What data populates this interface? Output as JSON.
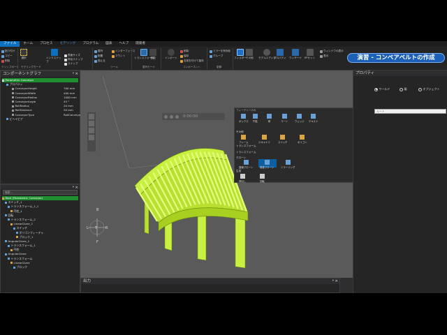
{
  "menu": [
    "ファイル",
    "ホーム",
    "プロセス",
    "モデリング",
    "プログラム",
    "図表",
    "ヘルプ",
    "開発者"
  ],
  "ribbon": {
    "clipboard_group": "クリップボード",
    "clipboard_items": [
      "貼り付け",
      "コピー",
      "削除"
    ],
    "select_label": "選択",
    "snap_label": "インクスナップ",
    "checks": [
      "表面サイズ",
      "押出スナップ",
      "スナップ"
    ],
    "modeling_group": "モデリングモード",
    "items2": [
      "整列",
      "配置",
      "揃える",
      "表示"
    ],
    "interface_items": [
      "インターフェース",
      "マウント"
    ],
    "tool_group": "ツール",
    "transform_label": "トランスフォーム",
    "move_label": "移動",
    "align_mode_label": "整列モード",
    "align_mode_group": "整列モード",
    "import_group": "インポート",
    "component_group": "コンポーネント",
    "component_items": [
      "削除",
      "保存",
      "名前を付けて保存"
    ],
    "filter_label": "フィルター",
    "filter_items": [
      "ミラー",
      "その他"
    ],
    "mirror_items": [
      "ミラーを有効化",
      "グループ"
    ],
    "model_group": "制御",
    "model_editor": "モデルエディタ",
    "property_label": "プロパティ",
    "wizard_label": "ウィザード",
    "window_items": [
      "ウィンドウの表示",
      "表示"
    ],
    "ep_label": "EPセット",
    "banner": "演習 - コンベアベルトの作成"
  },
  "component_graph": {
    "title": "コンポーネントグラフ",
    "root": "Parametric Conveyor",
    "prop_group": "プロパティ",
    "props": [
      {
        "name": "ConveyorHeight",
        "value": "700 mm"
      },
      {
        "name": "ConveyorWidth",
        "value": "400 mm"
      },
      {
        "name": "ConveyorRadius",
        "value": "1000 mm"
      },
      {
        "name": "ConveyorAngle",
        "value": "45 °"
      },
      {
        "name": "RollRadius",
        "value": "20 mm"
      },
      {
        "name": "RollDistance",
        "value": "50 mm"
      },
      {
        "name": "ConveyorType",
        "value": "RollConveyor"
      }
    ],
    "behavior": "ビヘイビア"
  },
  "node_tree": {
    "search_placeholder": "検索...",
    "rows": [
      "Root (Parametric Conveyor)",
      "スイッチ_1",
      "トランスフォーム_1_1",
      "円柱_1",
      "回転",
      "トランスフォーム_2",
      "LinearClone_1",
      "スイッチ",
      "ポリゴンフィーチャ",
      "ブロック_1",
      "AngularClone_1",
      "トランスフォーム_1",
      "円柱",
      "AngularClone",
      "トランスフォーム",
      "LinearClone",
      "ブロック"
    ]
  },
  "viewport": {
    "timecode": "0:00:00",
    "nav_labels": [
      "B",
      "L",
      "T",
      "R",
      "F"
    ]
  },
  "feature_menu": {
    "header": "フィーチャーのみ",
    "top_items": [
      "ボックス",
      "円柱",
      "球",
      "コーン",
      "ウェッジ",
      "テキスト"
    ],
    "section_other": "その他",
    "other_items": [
      "フレーム",
      "ジオメトリ",
      "スイッチ",
      "ポリゴン"
    ],
    "section_transform": "トランスフォーム",
    "transform_row": "トランスフォーム",
    "section_clone": "クローン",
    "clone_items": [
      "直線クローン",
      "角度クローン",
      "ミラーリング"
    ],
    "section_generate": "生成",
    "generate_items": [
      "押出し",
      "回転"
    ]
  },
  "properties": {
    "title": "プロパティ",
    "radio": [
      "ワールド",
      "親",
      "オブジェクト"
    ],
    "field_placeholder": "ルート"
  },
  "output": {
    "title": "出力"
  },
  "colors": {
    "accent": "#0e70c0",
    "model": "#c8f040",
    "selected": "#1e8f30"
  }
}
